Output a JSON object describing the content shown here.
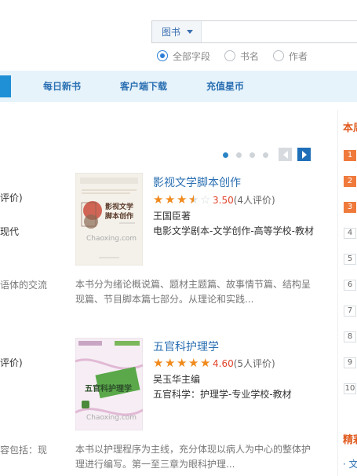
{
  "search": {
    "category": "图书",
    "radios": [
      {
        "label": "全部字段",
        "checked": true
      },
      {
        "label": "书名",
        "checked": false
      },
      {
        "label": "作者",
        "checked": false
      }
    ]
  },
  "nav": {
    "items": [
      "每日新书",
      "客户端下载",
      "充值星币"
    ]
  },
  "sidebar": {
    "title": "本周",
    "ranks": [
      "1",
      "2",
      "3",
      "4",
      "5",
      "6",
      "7",
      "8",
      "9",
      "10"
    ],
    "section2_title": "精彩",
    "link": "· 文"
  },
  "left_fragments": [
    "评价)",
    "现代",
    "语体的交流",
    "评价)",
    "容包括：现"
  ],
  "books": [
    {
      "title": "影视文学脚本创作",
      "rating": 3.5,
      "score": "3.50",
      "reviews": "(4人评价)",
      "author": "王国臣著",
      "category": "电影文学剧本-文学创作-高等学校-教材",
      "summary": "本书分为绪论概说篇、题材主题篇、故事情节篇、结构呈现篇、节目脚本篇七部分。从理论和实践...",
      "cover": {
        "title_text": "影视文学脚本创作",
        "watermark": "Chaoxing.com"
      }
    },
    {
      "title": "五官科护理学",
      "rating": 5,
      "score": "4.60",
      "reviews": "(5人评价)",
      "author": "吴玉华主编",
      "category": "五官科学：护理学-专业学校-教材",
      "summary": "本书以护理程序为主线，充分体现以病人为中心的整体护理进行编写。第一至三章为眼科护理...",
      "cover": {
        "title_text": "五官科护理学",
        "watermark": "Chaoxing.com"
      }
    }
  ],
  "colors": {
    "accent": "#2a6fb2",
    "orange": "#f08a1c",
    "score_red": "#e0432a"
  }
}
